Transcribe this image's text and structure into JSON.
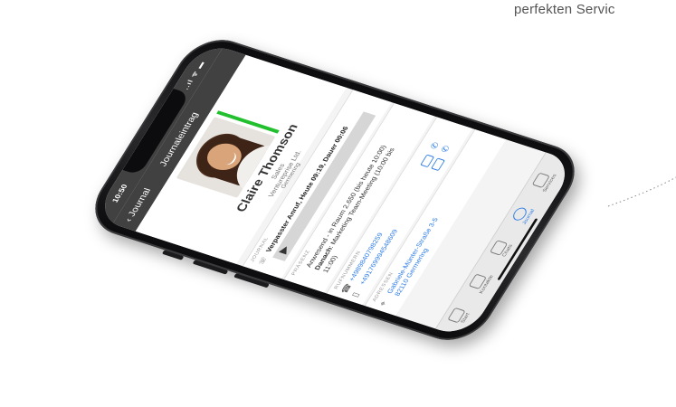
{
  "tagline": "perfekten Servic",
  "status": {
    "time": "10:50",
    "signal": "..ıl ᯤ ▬"
  },
  "nav": {
    "back_label": "Journal",
    "title": "Journaleintrag"
  },
  "contact": {
    "name": "Claire Thomson",
    "department": "Sales",
    "company": "Ventureprise Ltd.",
    "city": "Germering"
  },
  "journal": {
    "label": "JOURNAL",
    "entry": "Verpasster Anruf, Heute 09:19, Dauer 00:06"
  },
  "presence": {
    "label": "PRÄSENZ",
    "current": "Anwesend - in Raum 2.650 (bis heute 10:00)",
    "next_prefix": "Danach",
    "next": ": Marketing Team-Meeting (10:00 bis",
    "next_cont": "11:00)"
  },
  "phones": {
    "label": "RUFNUMMERN",
    "numbers": [
      "+4989840798259",
      "+491769994548609"
    ]
  },
  "address": {
    "label": "ADRESSEN",
    "street": "Gabriele-Münter-Straße 3-5",
    "city": "82110 Germering"
  },
  "tabs": [
    {
      "label": "Start"
    },
    {
      "label": "Kontakte"
    },
    {
      "label": "Chats"
    },
    {
      "label": "Journal"
    },
    {
      "label": "Services"
    }
  ],
  "colors": {
    "accent": "#2c7be5",
    "presence": "#22c02f",
    "header": "#414141"
  }
}
